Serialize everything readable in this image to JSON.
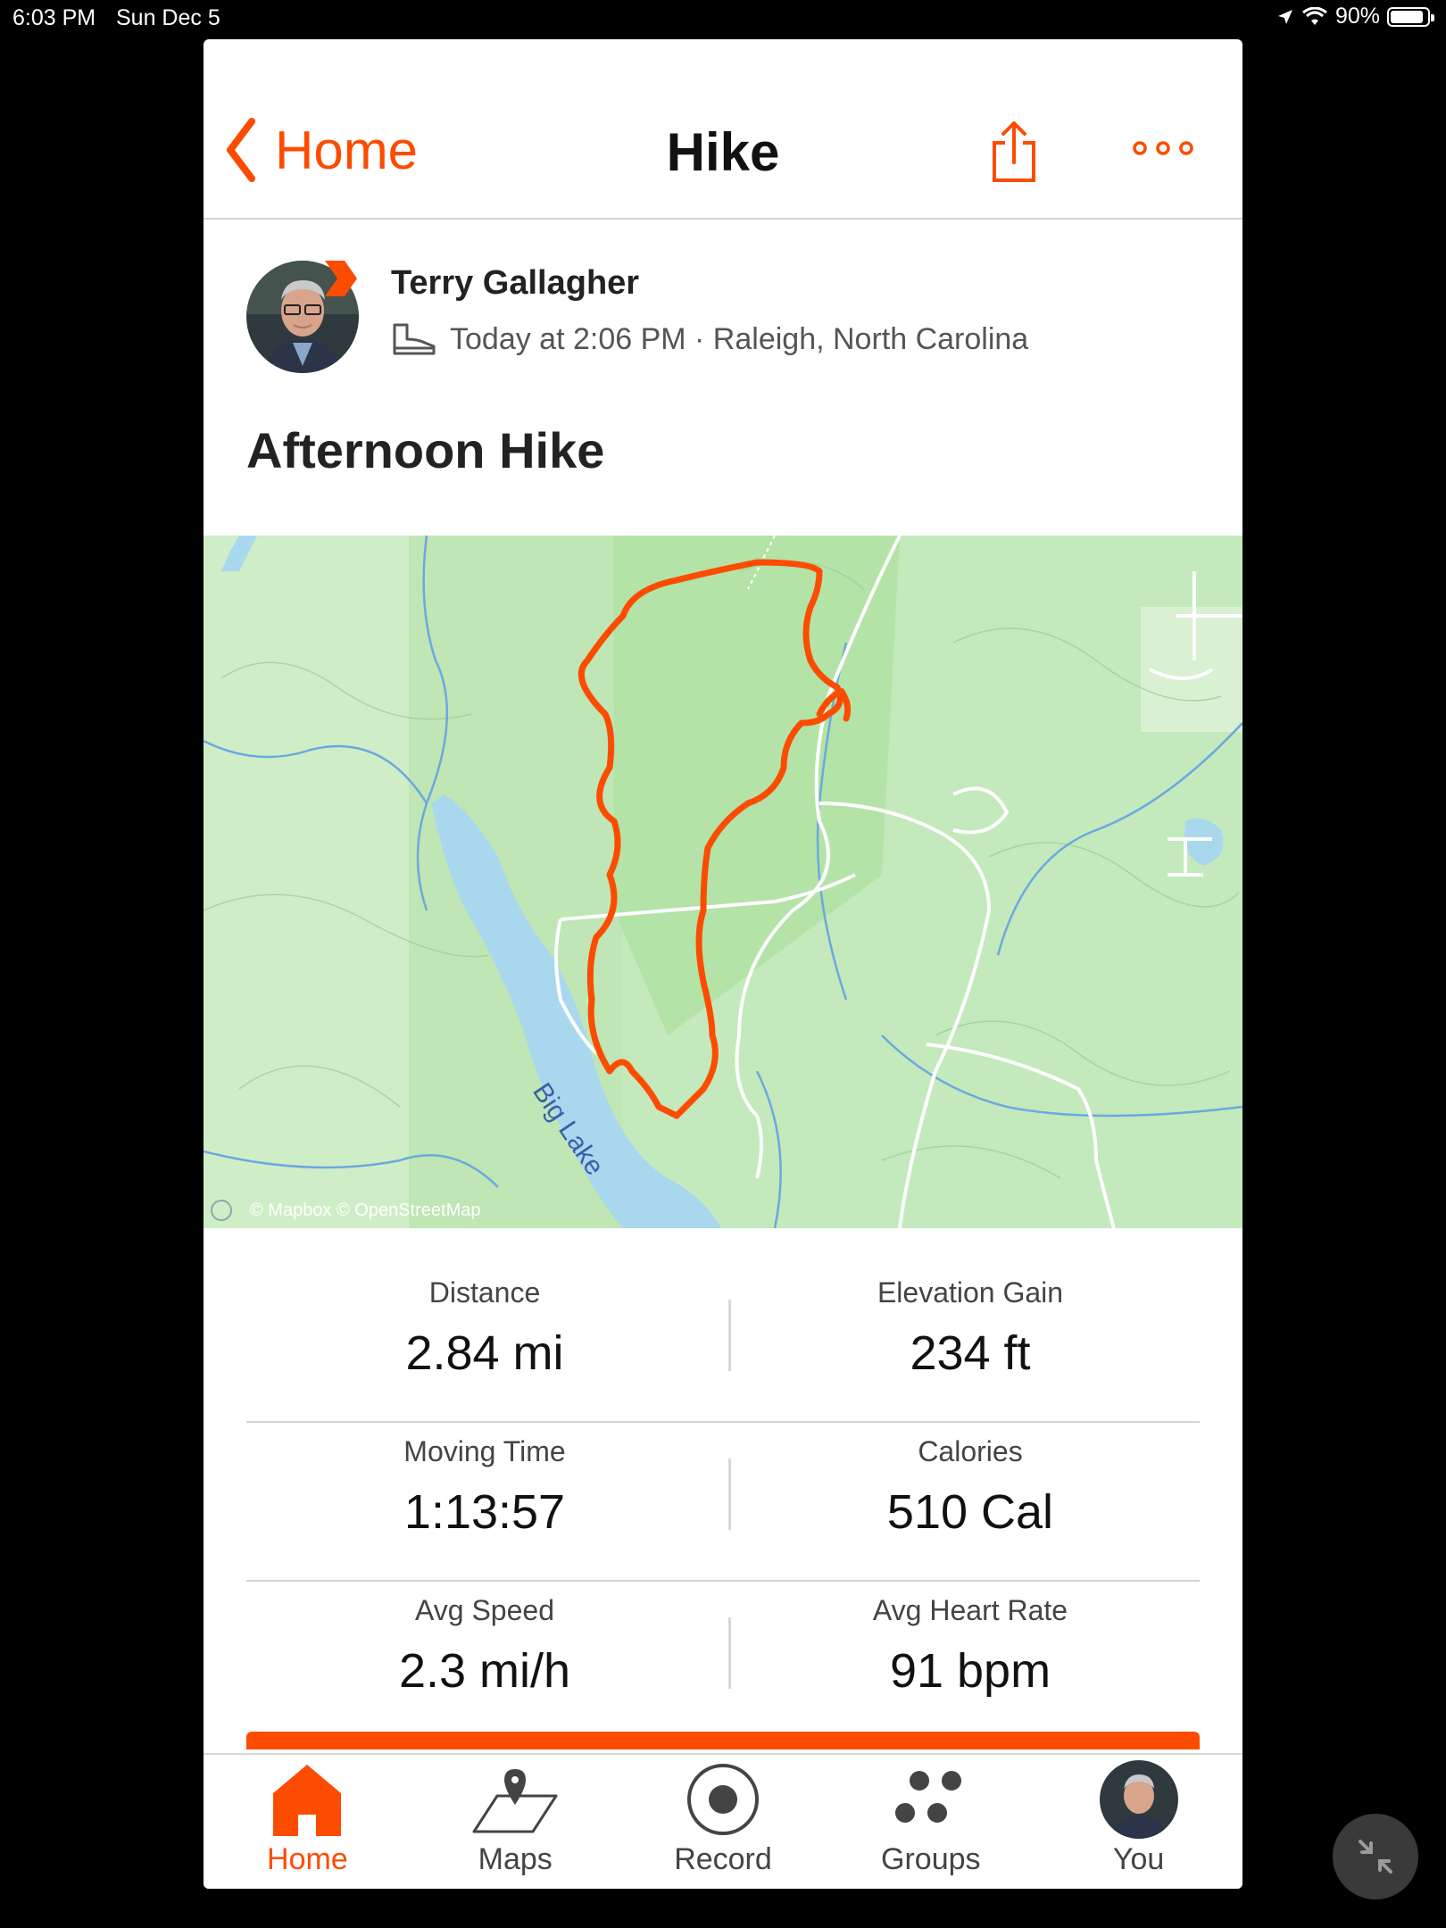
{
  "status_bar": {
    "time": "6:03 PM",
    "date": "Sun Dec 5",
    "battery": "90%",
    "battery_level": 0.9
  },
  "navbar": {
    "back_label": "Home",
    "title": "Hike"
  },
  "activity": {
    "athlete_name": "Terry Gallagher",
    "meta": "Today at 2:06 PM · Raleigh, North Carolina",
    "title": "Afternoon Hike"
  },
  "map": {
    "lake_label": "Big Lake",
    "attribution": "© Mapbox © OpenStreetMap"
  },
  "stats": [
    {
      "label": "Distance",
      "value": "2.84 mi"
    },
    {
      "label": "Elevation Gain",
      "value": "234 ft"
    },
    {
      "label": "Moving Time",
      "value": "1:13:57"
    },
    {
      "label": "Calories",
      "value": "510 Cal"
    },
    {
      "label": "Avg Speed",
      "value": "2.3 mi/h"
    },
    {
      "label": "Avg Heart Rate",
      "value": "91 bpm"
    }
  ],
  "tabs": [
    {
      "label": "Home",
      "icon": "home-icon",
      "active": true
    },
    {
      "label": "Maps",
      "icon": "maps-icon",
      "active": false
    },
    {
      "label": "Record",
      "icon": "record-icon",
      "active": false
    },
    {
      "label": "Groups",
      "icon": "groups-icon",
      "active": false
    },
    {
      "label": "You",
      "icon": "avatar",
      "active": false
    }
  ],
  "colors": {
    "accent": "#fc4c02",
    "map_green": "#b9e7b0",
    "water": "#a9d8ee"
  }
}
